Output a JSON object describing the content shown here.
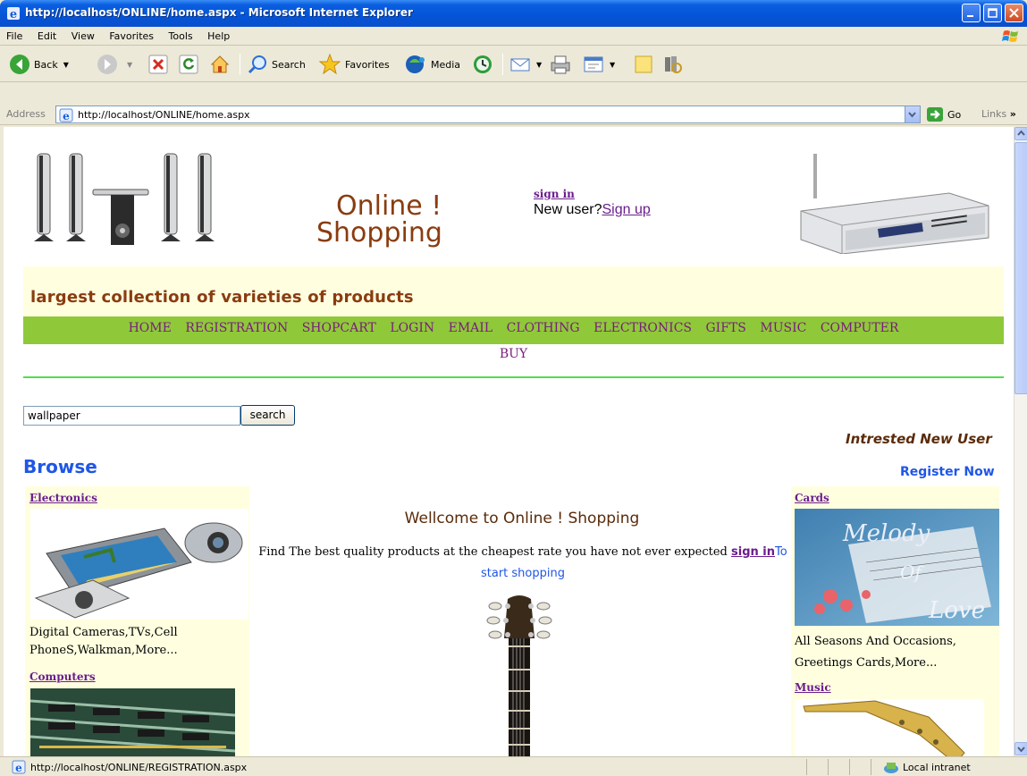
{
  "window": {
    "title": "http://localhost/ONLINE/home.aspx - Microsoft Internet Explorer"
  },
  "menu": [
    "File",
    "Edit",
    "View",
    "Favorites",
    "Tools",
    "Help"
  ],
  "toolbar": {
    "back": "Back",
    "search": "Search",
    "favorites": "Favorites",
    "media": "Media"
  },
  "address": {
    "label": "Address",
    "url": "http://localhost/ONLINE/home.aspx",
    "go": "Go",
    "links": "Links"
  },
  "header": {
    "logo_line1": "Online !",
    "logo_line2": "Shopping",
    "signin": "sign in",
    "new_user": "New user?",
    "signup": "Sign up",
    "tagline": "largest collection of varieties of products"
  },
  "nav": {
    "items": [
      "HOME",
      "REGISTRATION",
      "SHOPCART",
      "LOGIN",
      "EMAIL",
      "CLOTHING",
      "ELECTRONICS",
      "GIFTS",
      "MUSIC",
      "COMPUTER"
    ],
    "buy": "BUY"
  },
  "search": {
    "value": "wallpaper",
    "button": "search"
  },
  "sidebar_right": {
    "interested": "Intrested New User",
    "register": "Register Now"
  },
  "browse": {
    "title": "Browse",
    "left": [
      {
        "label": "Electronics",
        "desc1": "Digital Cameras,TVs,Cell",
        "desc2": "PhoneS,Walkman,More..."
      },
      {
        "label": "Computers"
      }
    ],
    "right": [
      {
        "label": "Cards",
        "desc1": "All Seasons And Occasions,",
        "desc2": "Greetings Cards,More..."
      },
      {
        "label": "Music"
      }
    ],
    "card_image_text": [
      "Melody",
      "Of",
      "Love"
    ]
  },
  "main": {
    "welcome": "Wellcome to Online ! Shopping",
    "find": "Find The best quality products at the cheapest rate you have not ever expected",
    "signin_link": "sign in",
    "to_start": "To start shopping"
  },
  "status": {
    "text": "http://localhost/ONLINE/REGISTRATION.aspx",
    "zone": "Local intranet"
  }
}
